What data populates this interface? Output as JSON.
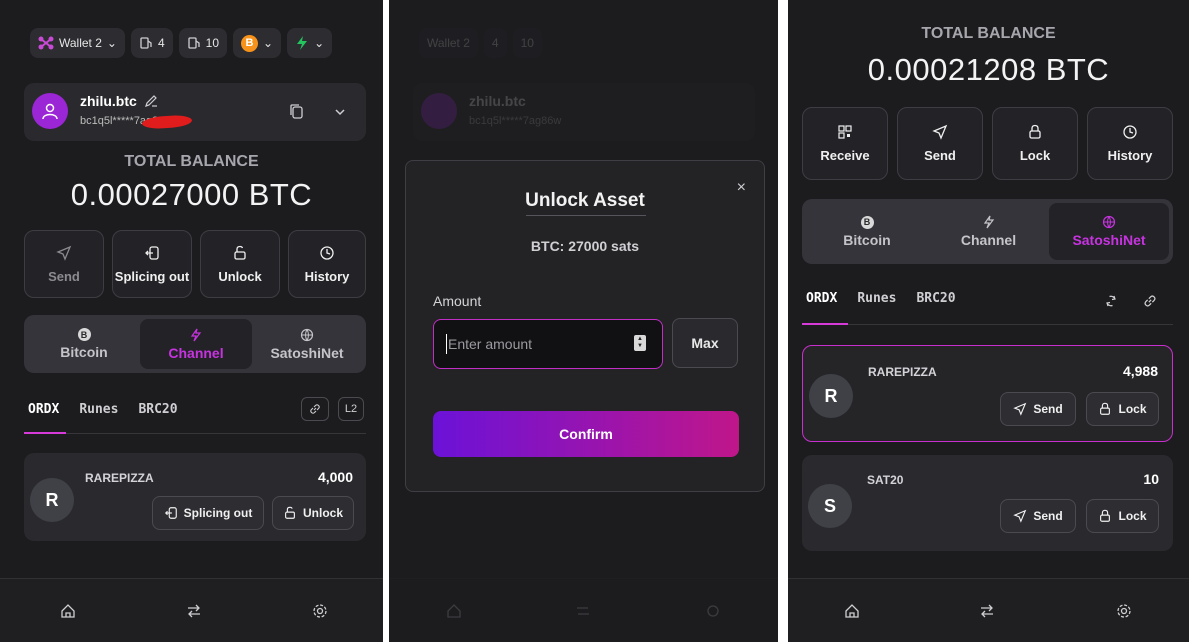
{
  "panel1": {
    "wallet_label": "Wallet 2",
    "counter_a": "4",
    "counter_b": "10",
    "account_name": "zhilu.btc",
    "account_address": "bc1q5l*****7ag86w",
    "total_label": "TOTAL BALANCE",
    "total_value": "0.00027000 BTC",
    "actions": [
      {
        "label": "Send",
        "icon": "send-icon"
      },
      {
        "label": "Splicing out",
        "icon": "splice-out-icon"
      },
      {
        "label": "Unlock",
        "icon": "unlock-icon"
      },
      {
        "label": "History",
        "icon": "history-icon"
      }
    ],
    "segments": [
      "Bitcoin",
      "Channel",
      "SatoshiNet"
    ],
    "active_segment": "Channel",
    "tabs": [
      "ORDX",
      "Runes",
      "BRC20"
    ],
    "l2_label": "L2",
    "assets": [
      {
        "letter": "R",
        "name": "RAREPIZZA",
        "amount": "4,000",
        "btn1": "Splicing out",
        "btn2": "Unlock"
      }
    ]
  },
  "panel2": {
    "modal_title": "Unlock Asset",
    "modal_subtitle": "BTC: 27000 sats",
    "amount_label": "Amount",
    "amount_placeholder": "Enter amount",
    "max_label": "Max",
    "confirm_label": "Confirm",
    "close_symbol": "×"
  },
  "panel3": {
    "total_label": "TOTAL BALANCE",
    "total_value": "0.00021208 BTC",
    "actions": [
      {
        "label": "Receive",
        "icon": "qr-code-icon"
      },
      {
        "label": "Send",
        "icon": "send-icon"
      },
      {
        "label": "Lock",
        "icon": "lock-icon"
      },
      {
        "label": "History",
        "icon": "history-icon"
      }
    ],
    "segments": [
      "Bitcoin",
      "Channel",
      "SatoshiNet"
    ],
    "active_segment": "SatoshiNet",
    "tabs": [
      "ORDX",
      "Runes",
      "BRC20"
    ],
    "assets": [
      {
        "letter": "R",
        "name": "RAREPIZZA",
        "amount": "4,988",
        "btn1": "Send",
        "btn2": "Lock"
      },
      {
        "letter": "S",
        "name": "SAT20",
        "amount": "10",
        "btn1": "Send",
        "btn2": "Lock"
      }
    ]
  },
  "colors": {
    "background": "#1c1c1f",
    "accent": "#c733e0",
    "bitcoin_orange": "#f7931a",
    "lightning_green": "#22c55e",
    "avatar_purple": "#9b26d6"
  }
}
